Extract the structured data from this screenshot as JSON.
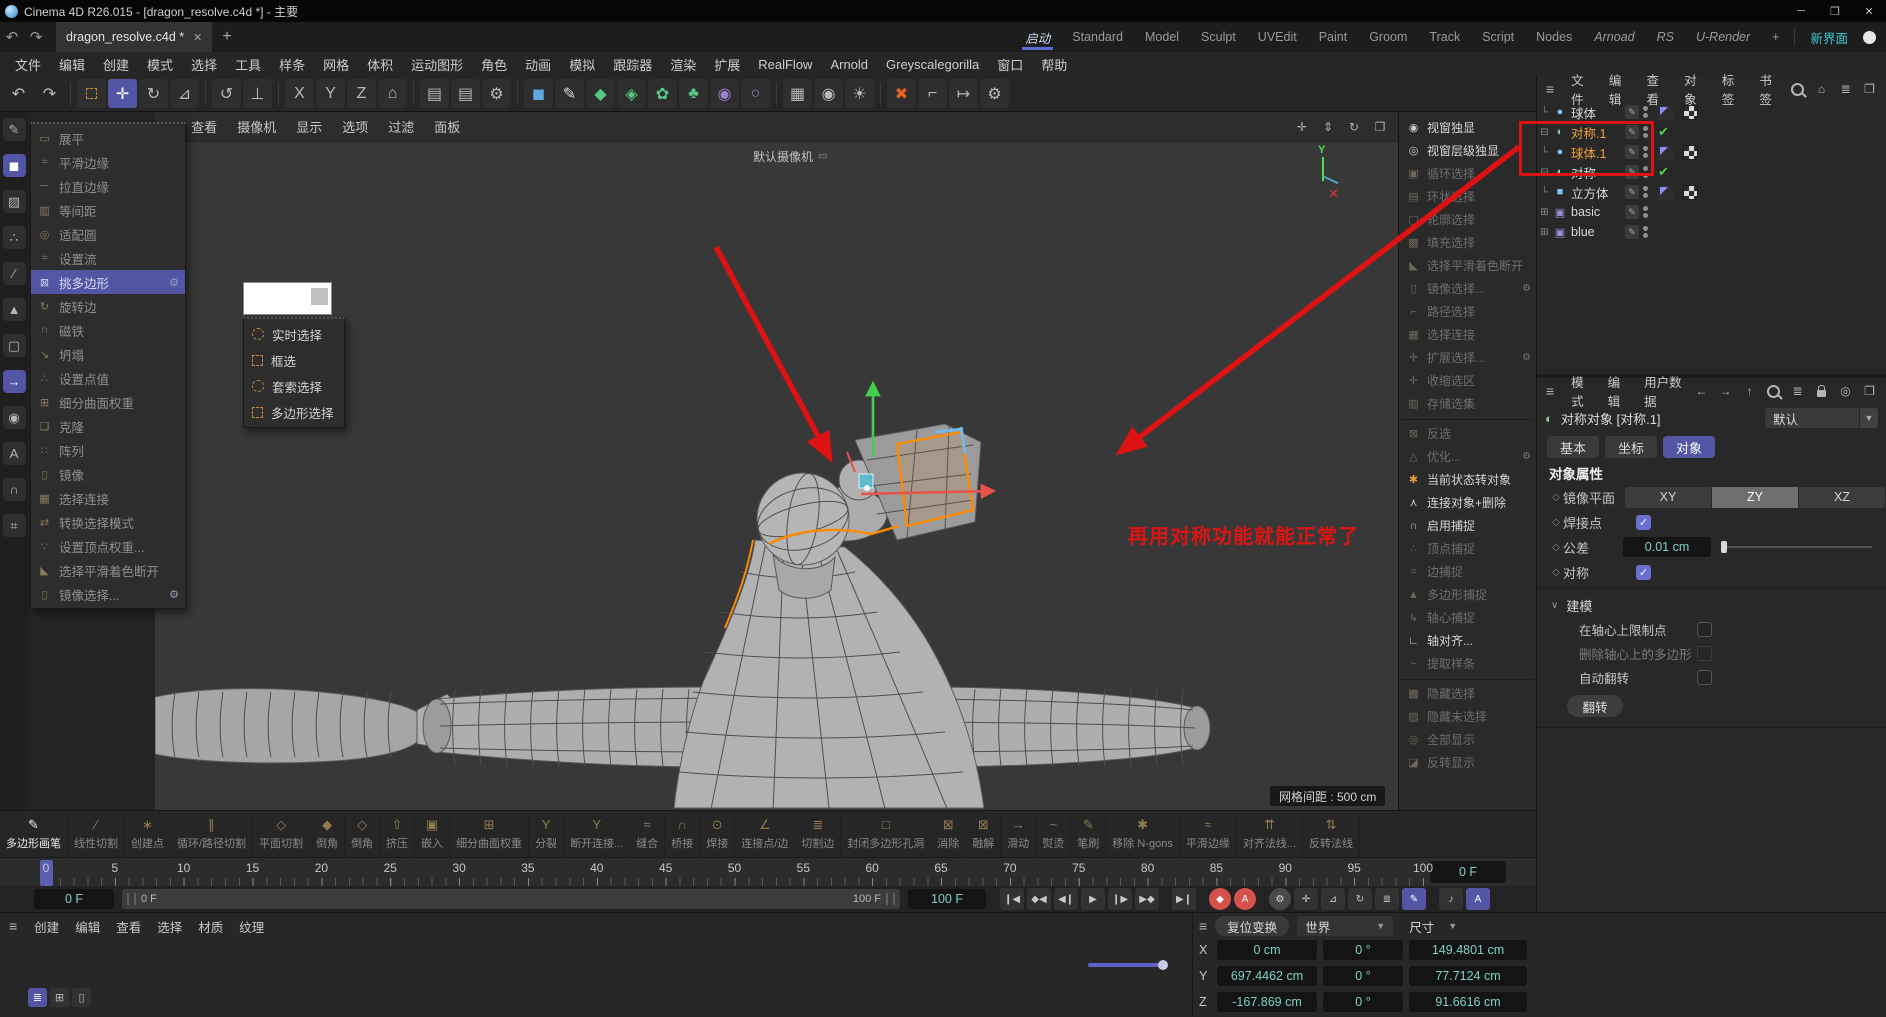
{
  "window": {
    "title": "Cinema 4D R26.015 - [dragon_resolve.c4d *] - 主要"
  },
  "tabrow": {
    "doc_tab": "dragon_resolve.c4d *",
    "layouts": [
      {
        "label": "启动",
        "active": true
      },
      {
        "label": "Standard"
      },
      {
        "label": "Model"
      },
      {
        "label": "Sculpt"
      },
      {
        "label": "UVEdit"
      },
      {
        "label": "Paint"
      },
      {
        "label": "Groom"
      },
      {
        "label": "Track"
      },
      {
        "label": "Script"
      },
      {
        "label": "Nodes"
      },
      {
        "label": "Arnoad",
        "italic": true
      },
      {
        "label": "RS",
        "italic": true
      },
      {
        "label": "U-Render",
        "italic": true
      }
    ],
    "add_label": "+",
    "new_layout": "新界面"
  },
  "menubar": [
    "文件",
    "编辑",
    "创建",
    "模式",
    "选择",
    "工具",
    "样条",
    "网格",
    "体积",
    "运动图形",
    "角色",
    "动画",
    "模拟",
    "跟踪器",
    "渲染",
    "扩展",
    "RealFlow",
    "Arnold",
    "Greyscalegorilla",
    "窗口",
    "帮助"
  ],
  "toolbar": [
    {
      "n": "undo-button",
      "g": "↶",
      "plain": true
    },
    {
      "n": "redo-button",
      "g": "↷",
      "plain": true
    },
    {
      "sep": true
    },
    {
      "n": "live-selection-tool",
      "dash": "box"
    },
    {
      "n": "move-tool",
      "g": "✛",
      "active": true
    },
    {
      "n": "rotate-tool",
      "g": "↻"
    },
    {
      "n": "scale-tool",
      "g": "⊿"
    },
    {
      "sep": true
    },
    {
      "n": "last-tool-button",
      "g": "↺"
    },
    {
      "n": "axis-lock-button",
      "g": "⊥"
    },
    {
      "sep": true
    },
    {
      "n": "x-axis-toggle",
      "g": "X"
    },
    {
      "n": "y-axis-toggle",
      "g": "Y"
    },
    {
      "n": "z-axis-toggle",
      "g": "Z"
    },
    {
      "n": "coord-system-toggle",
      "g": "⌂"
    },
    {
      "sep": true
    },
    {
      "n": "render-view-button",
      "g": "▤"
    },
    {
      "n": "render-picture-viewer-button",
      "g": "▤"
    },
    {
      "n": "render-settings-button",
      "g": "⚙"
    },
    {
      "sep": true
    },
    {
      "n": "add-cube-button",
      "g": "◼",
      "c": "#5fa8dc"
    },
    {
      "n": "add-pen-button",
      "g": "✎",
      "c": "#d8d8d8"
    },
    {
      "n": "add-subdivision-button",
      "g": "◆",
      "c": "#57c785"
    },
    {
      "n": "add-generator-button",
      "g": "◈",
      "c": "#57c785"
    },
    {
      "n": "add-cloner-button",
      "g": "✿",
      "c": "#57c785"
    },
    {
      "n": "add-field-button",
      "g": "♣",
      "c": "#57c785"
    },
    {
      "n": "add-volume-button",
      "g": "◉",
      "c": "#9a7fd0"
    },
    {
      "n": "add-spline-button",
      "g": "○",
      "c": "#9a7fd0"
    },
    {
      "sep": true
    },
    {
      "n": "add-floor-button",
      "g": "▦"
    },
    {
      "n": "add-camera-button",
      "g": "◉"
    },
    {
      "n": "add-light-button",
      "g": "☀"
    },
    {
      "sep": true
    },
    {
      "n": "xparticles-button",
      "g": "✖",
      "c": "#e8641e"
    },
    {
      "n": "bracket-tool-button",
      "g": "⌐"
    },
    {
      "n": "export-button",
      "g": "↦"
    },
    {
      "n": "toolbar-settings-button",
      "g": "⚙"
    }
  ],
  "left_toolbar": [
    {
      "n": "make-editable-icon",
      "g": "✎"
    },
    {
      "n": "model-mode-icon",
      "g": "◼",
      "active": true
    },
    {
      "n": "texture-mode-icon",
      "g": "▨"
    },
    {
      "n": "points-mode-icon",
      "g": "∴"
    },
    {
      "n": "edges-mode-icon",
      "g": "∕"
    },
    {
      "n": "polygons-mode-icon",
      "g": "▲"
    },
    {
      "n": "uv-mode-icon",
      "g": "▢"
    },
    {
      "n": "axis-mode-icon",
      "g": "→",
      "active": true
    },
    {
      "n": "solo-mode-icon",
      "g": "◉"
    },
    {
      "n": "annotate-mode-icon",
      "g": "A"
    },
    {
      "n": "snap-mode-icon",
      "g": "∩"
    },
    {
      "n": "workplane-mode-icon",
      "g": "⌗"
    }
  ],
  "viewport": {
    "menu": [
      "查看",
      "摄像机",
      "显示",
      "选项",
      "过滤",
      "面板"
    ],
    "nav": [
      {
        "n": "pan-view-icon",
        "g": "✛"
      },
      {
        "n": "zoom-view-icon",
        "g": "⇕"
      },
      {
        "n": "rotate-view-icon",
        "g": "↻"
      },
      {
        "n": "toggle-view-icon",
        "g": "❐"
      }
    ],
    "camera_label": "默认摄像机",
    "axis_y": "Y",
    "grid_badge": "网格间距 : 500 cm",
    "annotation": "再用对称功能就能正常了"
  },
  "flyout_menu": {
    "items": [
      {
        "label": "展平",
        "icon": "▭"
      },
      {
        "label": "平滑边缘",
        "icon": "≈"
      },
      {
        "label": "拉直边缘",
        "icon": "─"
      },
      {
        "label": "等间距",
        "icon": "▥"
      },
      {
        "label": "适配圆",
        "icon": "◎"
      },
      {
        "label": "设置流",
        "icon": "≈"
      },
      {
        "label": "挑多边形",
        "icon": "⊠",
        "active": true,
        "gear": true
      },
      {
        "label": "旋转边",
        "icon": "↻"
      },
      {
        "label": "磁铁",
        "icon": "∩"
      },
      {
        "label": "坍塌",
        "icon": "↘"
      },
      {
        "label": "设置点值",
        "icon": "∴"
      },
      {
        "label": "细分曲面权重",
        "icon": "⊞"
      },
      {
        "label": "克隆",
        "icon": "❏"
      },
      {
        "label": "阵列",
        "icon": "∷"
      },
      {
        "label": "镜像",
        "icon": "▯"
      },
      {
        "label": "选择连接",
        "icon": "▦"
      },
      {
        "label": "转换选择模式",
        "icon": "⇄"
      },
      {
        "label": "设置顶点权重...",
        "icon": "∵"
      },
      {
        "label": "选择平滑着色断开",
        "icon": "◣"
      },
      {
        "label": "镜像选择...",
        "icon": "▯",
        "gear": true
      }
    ]
  },
  "context_menu": {
    "items": [
      {
        "label": "实时选择",
        "shape": "circle"
      },
      {
        "label": "框选",
        "shape": "box"
      },
      {
        "label": "套索选择",
        "shape": "circle"
      },
      {
        "label": "多边形选择",
        "shape": "box"
      }
    ]
  },
  "palette": {
    "items": [
      {
        "label": "视窗独显",
        "icon": "◉",
        "en": true
      },
      {
        "label": "视窗层级独显",
        "icon": "◎",
        "en": true
      },
      {
        "label": "循环选择",
        "icon": "▣"
      },
      {
        "label": "环状选择",
        "icon": "▤"
      },
      {
        "label": "轮廓选择",
        "icon": "▢"
      },
      {
        "label": "填充选择",
        "icon": "▩"
      },
      {
        "label": "选择平滑着色断开",
        "icon": "◣"
      },
      {
        "label": "镜像选择...",
        "icon": "▯",
        "gear": true
      },
      {
        "label": "路径选择",
        "icon": "⌐"
      },
      {
        "label": "选择连接",
        "icon": "▦"
      },
      {
        "label": "扩展选择...",
        "icon": "✛",
        "gear": true
      },
      {
        "label": "收缩选区",
        "icon": "✛"
      },
      {
        "label": "存储选集",
        "icon": "▥",
        "sep_after": true
      },
      {
        "label": "反选",
        "icon": "⊠"
      },
      {
        "label": "优化...",
        "icon": "△",
        "gear": true
      },
      {
        "label": "当前状态转对象",
        "icon": "✱",
        "en": true,
        "ic": "#e09f3c"
      },
      {
        "label": "连接对象+删除",
        "icon": "⋏",
        "en": true
      },
      {
        "label": "启用捕捉",
        "icon": "∩",
        "en": true
      },
      {
        "label": "顶点捕捉",
        "icon": "∴"
      },
      {
        "label": "边捕捉",
        "icon": "="
      },
      {
        "label": "多边形捕捉",
        "icon": "▲"
      },
      {
        "label": "轴心捕捉",
        "icon": "↳"
      },
      {
        "label": "轴对齐...",
        "icon": "∟",
        "en": true
      },
      {
        "label": "提取样条",
        "icon": "~",
        "sep_after": true
      },
      {
        "label": "隐藏选择",
        "icon": "▩"
      },
      {
        "label": "隐藏未选择",
        "icon": "▨"
      },
      {
        "label": "全部显示",
        "icon": "◎"
      },
      {
        "label": "反转显示",
        "icon": "◪"
      }
    ]
  },
  "object_manager": {
    "menu": [
      "文件",
      "编辑",
      "查看",
      "对象",
      "标签",
      "书签"
    ],
    "rows": [
      {
        "label": "球体",
        "type": "sphere",
        "child": true,
        "tags": true
      },
      {
        "label": "对称.1",
        "type": "symmetry",
        "expand": "⊟",
        "sel": true,
        "check": true
      },
      {
        "label": "球体.1",
        "type": "sphere",
        "child": true,
        "sel": true,
        "tags": true
      },
      {
        "label": "对称",
        "type": "symmetry",
        "expand": "⊟",
        "check": true
      },
      {
        "label": "立方体",
        "type": "cube",
        "child": true,
        "tags": true
      },
      {
        "label": "basic",
        "type": "layer",
        "expand": "⊞"
      },
      {
        "label": "blue",
        "type": "layer",
        "expand": "⊞"
      }
    ]
  },
  "attributes": {
    "menu": [
      "模式",
      "编辑",
      "用户数据"
    ],
    "title": "对称对象 [对称.1]",
    "preset": "默认",
    "tabs": [
      "基本",
      "坐标",
      "对象"
    ],
    "active_tab": "对象",
    "section": "对象属性",
    "mirror_label": "镜像平面",
    "mirror_options": [
      "XY",
      "ZY",
      "XZ"
    ],
    "mirror_active": "ZY",
    "weld_label": "焊接点",
    "tolerance_label": "公差",
    "tolerance_value": "0.01 cm",
    "symmetry_label": "对称",
    "modeling_label": "建模",
    "restrict_label": "在轴心上限制点",
    "delete_label": "删除轴心上的多边形",
    "autoflip_label": "自动翻转",
    "flip_button": "翻转"
  },
  "shelf": {
    "tools": [
      {
        "label": "多边形画笔",
        "g": "✎",
        "active": true
      },
      {
        "label": "线性切割",
        "g": "∕"
      },
      {
        "label": "创建点",
        "g": "∗"
      },
      {
        "label": "循环/路径切割",
        "g": "∥"
      },
      {
        "label": "平面切割",
        "g": "◇"
      },
      {
        "label": "倒角",
        "g": "◆"
      },
      {
        "label": "倒角",
        "g": "◇"
      },
      {
        "label": "挤压",
        "g": "⇧"
      },
      {
        "label": "嵌入",
        "g": "▣"
      },
      {
        "label": "细分曲面权重",
        "g": "⊞"
      },
      {
        "label": "分裂",
        "g": "Y"
      },
      {
        "label": "断开连接...",
        "g": "Y"
      },
      {
        "label": "缝合",
        "g": "≈"
      },
      {
        "label": "桥接",
        "g": "∩"
      },
      {
        "label": "焊接",
        "g": "⊙"
      },
      {
        "label": "连接点/边",
        "g": "∠"
      },
      {
        "label": "切割边",
        "g": "≣"
      },
      {
        "label": "封闭多边形孔洞",
        "g": "□"
      },
      {
        "label": "消除",
        "g": "⊠"
      },
      {
        "label": "融解",
        "g": "⊠"
      },
      {
        "label": "滑动",
        "g": "→"
      },
      {
        "label": "熨烫",
        "g": "~"
      },
      {
        "label": "笔刷",
        "g": "✎"
      },
      {
        "label": "移除 N-gons",
        "g": "✱"
      },
      {
        "label": "平滑边缘",
        "g": "≈"
      },
      {
        "label": "对齐法线...",
        "g": "⇈"
      },
      {
        "label": "反转法线",
        "g": "⇅"
      }
    ]
  },
  "timeline": {
    "ruler": [
      "0",
      "5",
      "10",
      "15",
      "20",
      "25",
      "30",
      "35",
      "40",
      "45",
      "50",
      "55",
      "60",
      "65",
      "70",
      "75",
      "80",
      "85",
      "90",
      "95",
      "100"
    ],
    "current_frame": "0 F",
    "range_start_box": "0 F",
    "range_start": "0 F",
    "range_end": "100 F",
    "range_end_box": "100 F"
  },
  "transport": [
    {
      "n": "goto-start-button",
      "g": "❙◀"
    },
    {
      "n": "prev-key-button",
      "g": "◆◀"
    },
    {
      "n": "prev-frame-button",
      "g": "◀❙"
    },
    {
      "n": "play-button",
      "g": "▶"
    },
    {
      "n": "next-frame-button",
      "g": "❙▶"
    },
    {
      "n": "next-key-button",
      "g": "▶◆"
    },
    {
      "gap": true
    },
    {
      "n": "goto-end-button",
      "g": "▶❙"
    },
    {
      "gap": true
    },
    {
      "n": "record-keyframe-button",
      "g": "◆",
      "red": true
    },
    {
      "n": "autokey-button",
      "g": "A",
      "red": true
    },
    {
      "gap": true
    },
    {
      "n": "keying-settings-button",
      "g": "⚙",
      "circ": true
    },
    {
      "n": "record-position-button",
      "g": "✛"
    },
    {
      "n": "record-scale-button",
      "g": "⊿"
    },
    {
      "n": "record-rotation-button",
      "g": "↻"
    },
    {
      "n": "record-parameter-button",
      "g": "≣"
    },
    {
      "n": "record-point-level-button",
      "g": "✎",
      "blue": true
    },
    {
      "gap": true
    },
    {
      "n": "sound-button",
      "g": "♪"
    },
    {
      "n": "autokey-selection-button",
      "g": "A",
      "blue": true
    }
  ],
  "coords": {
    "reset": "复位变换",
    "space": "世界",
    "dims": "尺寸",
    "rows": [
      {
        "axis": "X",
        "pos": "0 cm",
        "rot": "0 °",
        "size": "149.4801 cm"
      },
      {
        "axis": "Y",
        "pos": "697.4462 cm",
        "rot": "0 °",
        "size": "77.7124 cm"
      },
      {
        "axis": "Z",
        "pos": "-167.869 cm",
        "rot": "0 °",
        "size": "91.6616 cm"
      }
    ]
  },
  "materials": {
    "menu": [
      "创建",
      "编辑",
      "查看",
      "选择",
      "材质",
      "纹理"
    ],
    "views": [
      {
        "n": "material-list-view-button",
        "g": "≣",
        "active": true
      },
      {
        "n": "material-grid-view-button",
        "g": "⊞"
      },
      {
        "n": "material-single-view-button",
        "g": "▯"
      }
    ]
  },
  "colors": {
    "accent": "#5356a5",
    "value_cyan": "#7fd2c8",
    "annotation_red": "#dd1414",
    "selection_orange": "#ff8a00",
    "check_green": "#49d157",
    "selected_object_orange": "#f0a23c"
  }
}
